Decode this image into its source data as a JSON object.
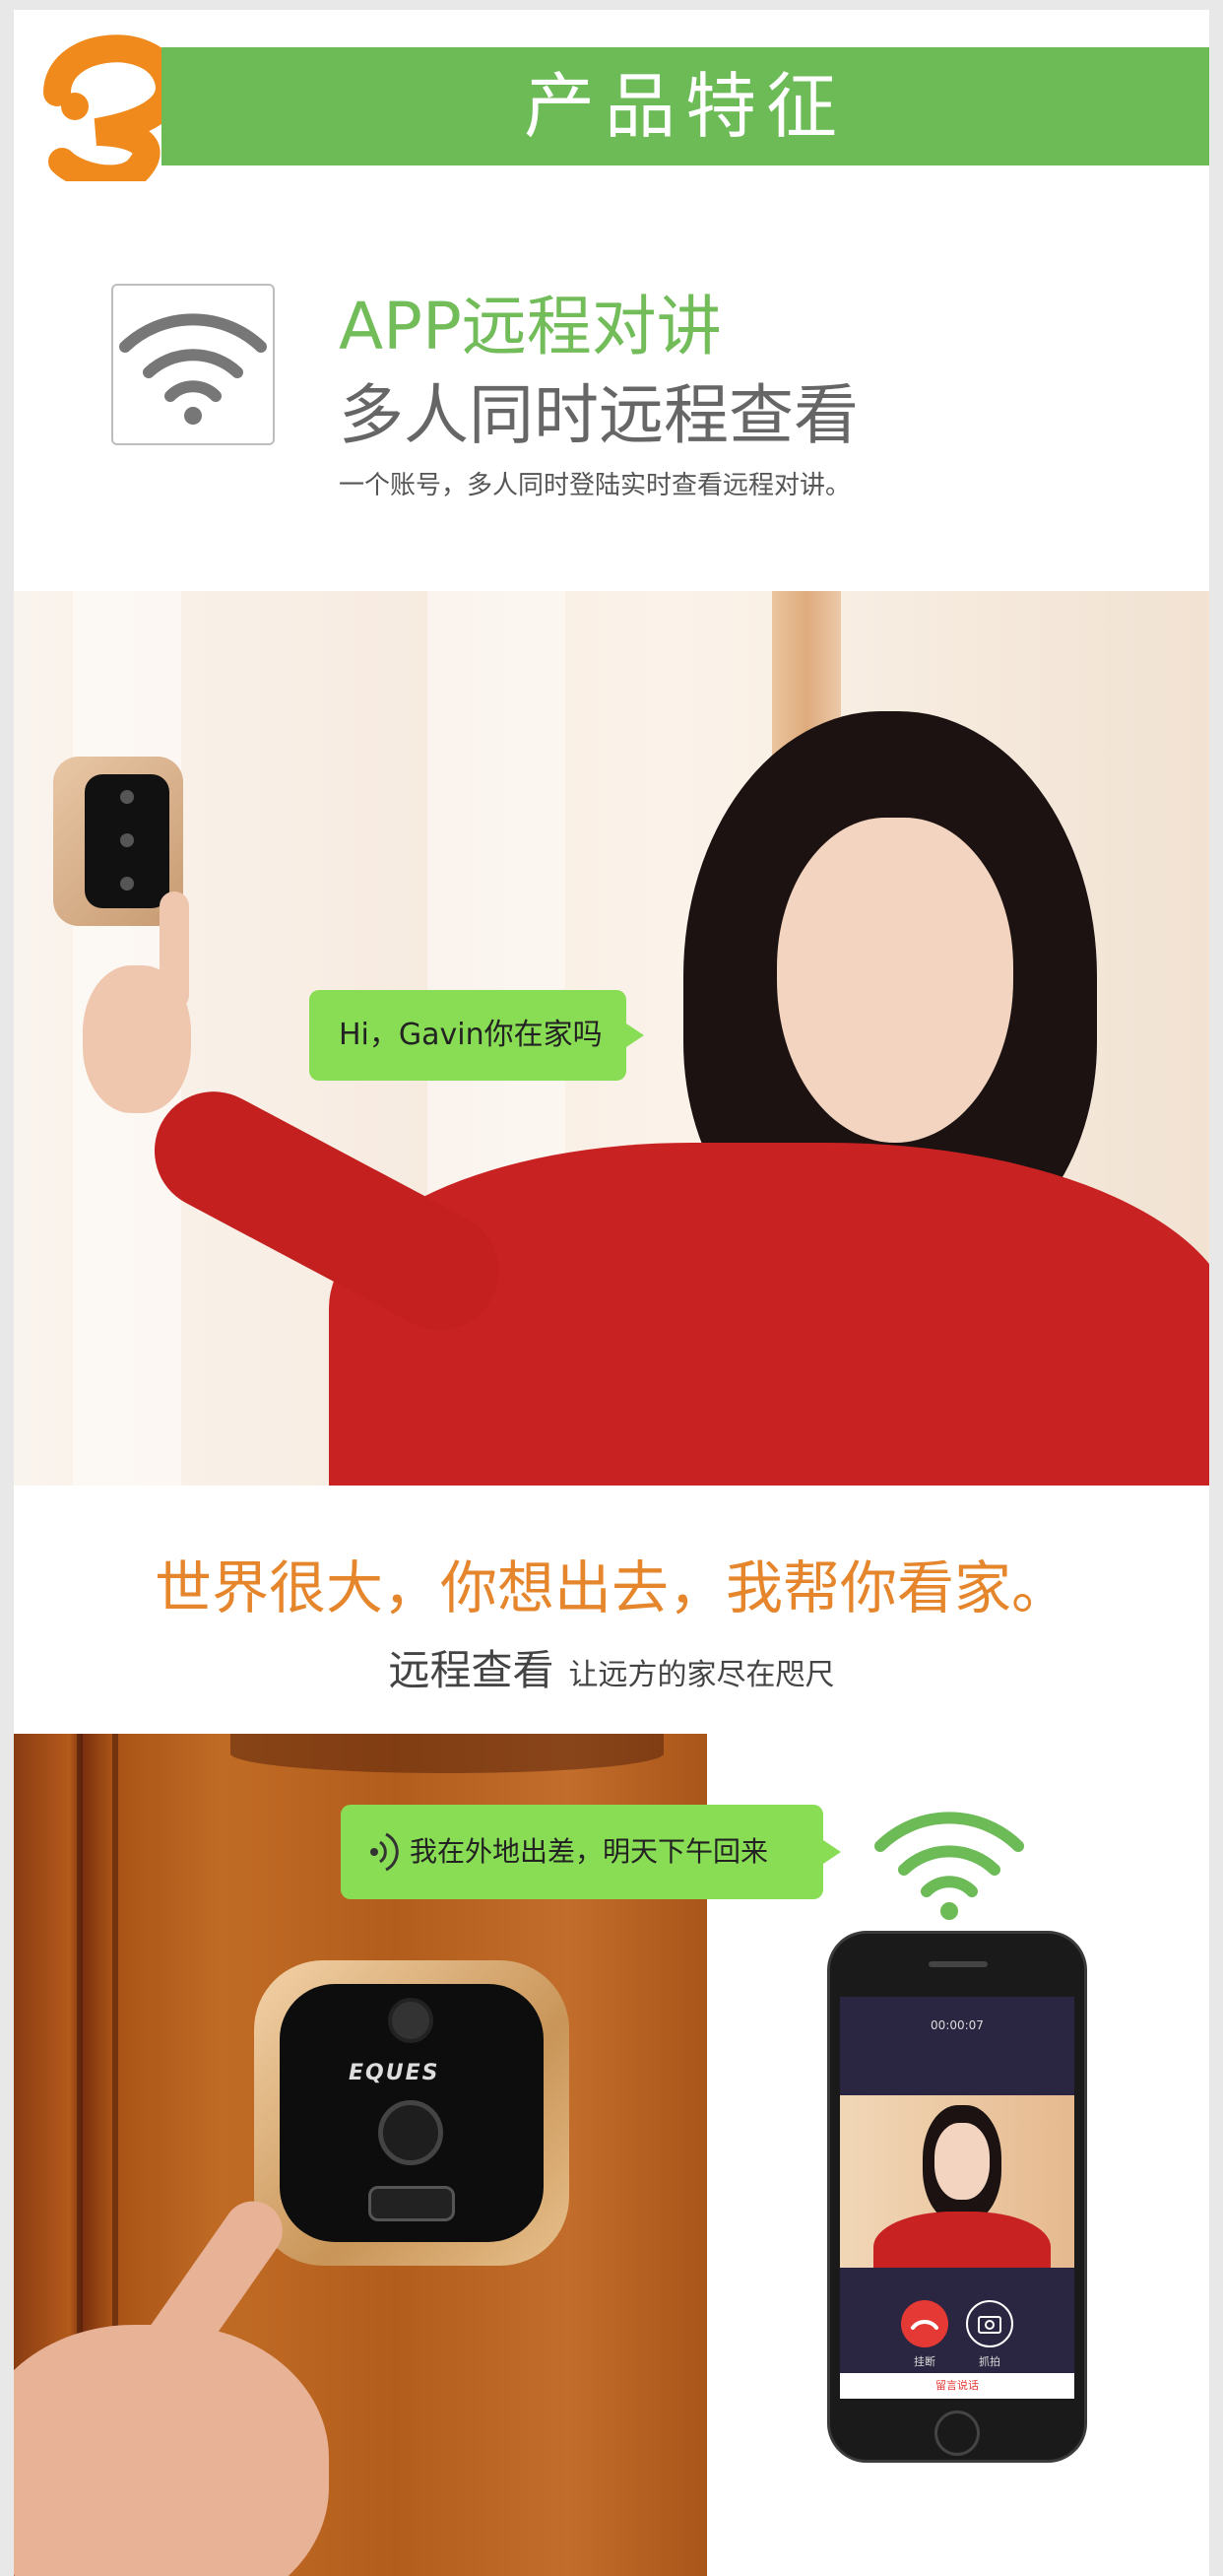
{
  "header": {
    "title": "产品特征"
  },
  "feature": {
    "title": "APP远程对讲",
    "subtitle": "多人同时远程查看",
    "description": "一个账号，多人同时登陆实时查看远程对讲。"
  },
  "photo1": {
    "bubble": "Hi，Gavin你在家吗"
  },
  "slogan": {
    "headline": "世界很大，你想出去，我帮你看家。",
    "remote_title": "远程查看",
    "remote_desc": "让远方的家尽在咫尺"
  },
  "photo2": {
    "bubble": "我在外地出差，明天下午回来",
    "device_brand": "EQUES",
    "phone": {
      "call_time": "00:00:07",
      "hangup_label": "挂断",
      "snapshot_label": "抓拍",
      "message_bar": "留言说话"
    }
  },
  "colors": {
    "green": "#6cbb57",
    "bubble": "#88dd55",
    "orange": "#e5862c",
    "logo": "#f08a1c"
  }
}
